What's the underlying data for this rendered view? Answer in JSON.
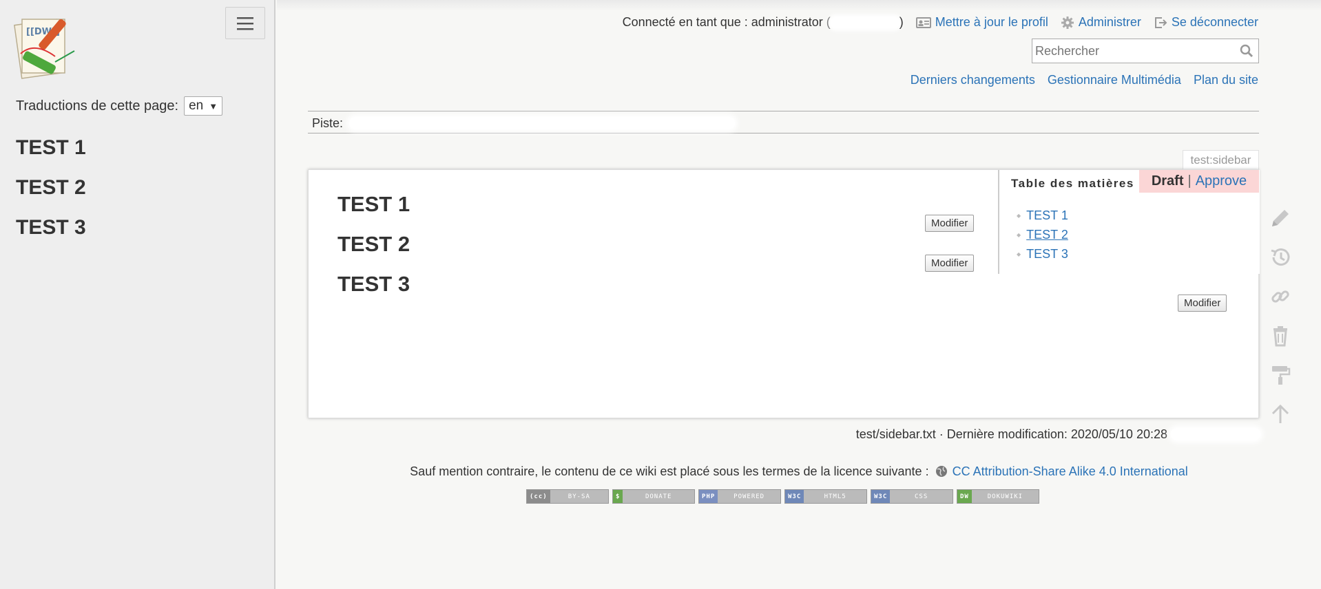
{
  "sidebar": {
    "logo_text": "[[DW]]",
    "translations_label": "Traductions de cette page:",
    "language": "en",
    "headings": [
      "TEST 1",
      "TEST 2",
      "TEST 3"
    ]
  },
  "userbar": {
    "connected_prefix": "Connecté en tant que : administrator (",
    "connected_suffix": ")",
    "update_profile": "Mettre à jour le profil",
    "admin": "Administrer",
    "logout": "Se déconnecter"
  },
  "search": {
    "placeholder": "Rechercher"
  },
  "sitelinks": {
    "recent": "Derniers changements",
    "media": "Gestionnaire Multimédia",
    "sitemap": "Plan du site"
  },
  "breadcrumbs": {
    "label": "Piste:"
  },
  "page": {
    "id": "test:sidebar",
    "headings": [
      "TEST 1",
      "TEST 2",
      "TEST 3"
    ],
    "edit_label": "Modifier"
  },
  "approval": {
    "status": "Draft",
    "separator": "|",
    "action": "Approve"
  },
  "toc": {
    "title": "Table des matières",
    "items": [
      "TEST 1",
      "TEST 2",
      "TEST 3"
    ]
  },
  "docinfo": "test/sidebar.txt · Dernière modification: 2020/05/10 20:28",
  "license": {
    "text": "Sauf mention contraire, le contenu de ce wiki est placé sous les termes de la licence suivante :",
    "link": "CC Attribution-Share Alike 4.0 International"
  },
  "badges": [
    {
      "tag": "(cc)",
      "text": "BY-SA",
      "color": "#8c8c8c"
    },
    {
      "tag": "$",
      "text": "DONATE",
      "color": "#6aa84f"
    },
    {
      "tag": "PHP",
      "text": "POWERED",
      "color": "#7b8fc0"
    },
    {
      "tag": "W3C",
      "text": "HTML5",
      "color": "#6f88b8"
    },
    {
      "tag": "W3C",
      "text": "CSS",
      "color": "#6f88b8"
    },
    {
      "tag": "DW",
      "text": "DOKUWIKI",
      "color": "#6aa84f"
    }
  ],
  "colors": {
    "link": "#2b73b7",
    "draft_bg": "#fbd6d6",
    "sidebar_bg": "#eeeeee"
  }
}
